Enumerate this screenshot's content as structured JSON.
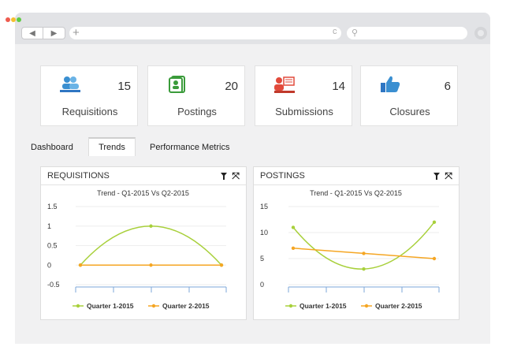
{
  "browser": {
    "dots": [
      "#ee5b4f",
      "#f5bf2f",
      "#5ecb43"
    ],
    "back": "◀",
    "forward": "▶",
    "new_tab": "+",
    "refresh": "c",
    "search_icon": "magnifier-icon"
  },
  "stats": [
    {
      "count": "15",
      "label": "Requisitions",
      "icon": "users-icon",
      "color": "#3a8fd1"
    },
    {
      "count": "20",
      "label": "Postings",
      "icon": "posting-icon",
      "color": "#3a9b3a"
    },
    {
      "count": "14",
      "label": "Submissions",
      "icon": "submission-icon",
      "color": "#e24a3b"
    },
    {
      "count": "6",
      "label": "Closures",
      "icon": "thumbs-up-icon",
      "color": "#2f76c3"
    }
  ],
  "tabs": [
    {
      "label": "Dashboard",
      "active": false
    },
    {
      "label": "Trends",
      "active": true
    },
    {
      "label": "Performance Metrics",
      "active": false
    }
  ],
  "panels": [
    {
      "title": "REQUISITIONS",
      "expand_icon": "⤧",
      "chart_data": {
        "type": "line",
        "title": "Trend - Q1-2015 Vs Q2-2015",
        "x": [
          1,
          2,
          3
        ],
        "ylim": [
          -0.5,
          1.5
        ],
        "yticks": [
          "1.5",
          "1",
          "0.5",
          "0",
          "-0.5"
        ],
        "series": [
          {
            "name": "Quarter 1-2015",
            "values": [
              0,
              1,
              0
            ],
            "color": "#a8d03b",
            "smooth": true
          },
          {
            "name": "Quarter 2-2015",
            "values": [
              0,
              0,
              0
            ],
            "color": "#f5a623",
            "smooth": false
          }
        ]
      }
    },
    {
      "title": "POSTINGS",
      "expand_icon": "⤧",
      "chart_data": {
        "type": "line",
        "title": "Trend - Q1-2015 Vs Q2-2015",
        "x": [
          1,
          2,
          3
        ],
        "ylim": [
          0,
          15
        ],
        "yticks": [
          "15",
          "10",
          "5",
          "0"
        ],
        "series": [
          {
            "name": "Quarter 1-2015",
            "values": [
              11,
              3,
              12
            ],
            "color": "#a8d03b",
            "smooth": true
          },
          {
            "name": "Quarter 2-2015",
            "values": [
              7,
              6,
              5
            ],
            "color": "#f5a623",
            "smooth": false
          }
        ]
      }
    }
  ]
}
